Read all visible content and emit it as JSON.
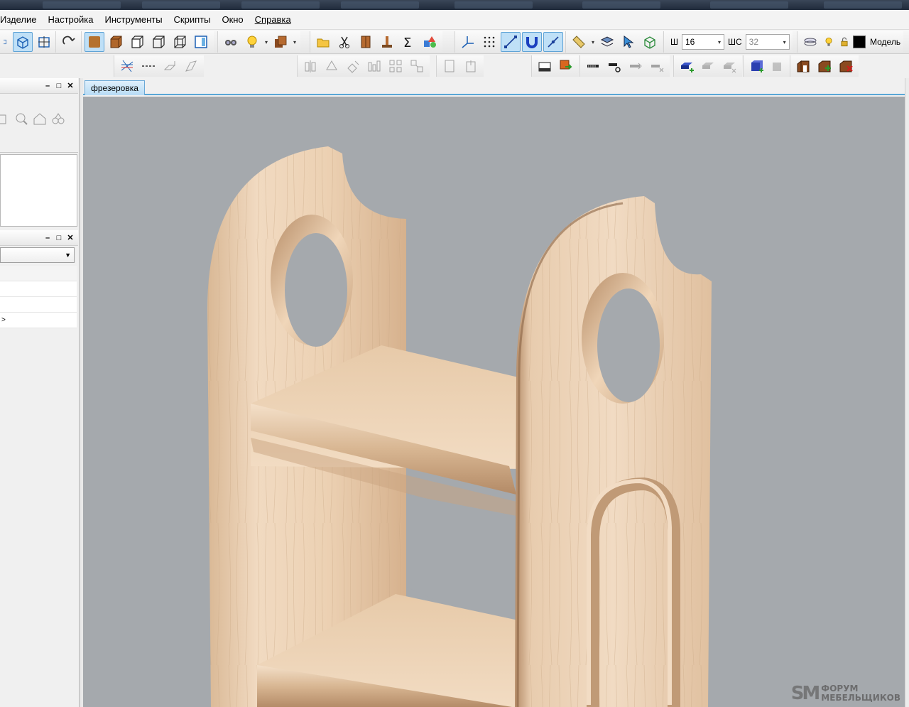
{
  "menu": {
    "items": [
      "Изделие",
      "Настройка",
      "Инструменты",
      "Скрипты",
      "Окно",
      "Справка"
    ]
  },
  "toolbar": {
    "width_label": "Ш",
    "width_value": "16",
    "shs_label": "ШС",
    "shs_value": "32",
    "model_label": "Модель",
    "color_hex": "#000000"
  },
  "tabs": [
    {
      "label": "фрезеровка",
      "active": true
    }
  ],
  "left_panel": {
    "row_marker": ">"
  },
  "watermark": {
    "logo": "SM",
    "line1": "ФОРУМ",
    "line2": "МЕБЕЛЬЩИКОВ"
  },
  "colors": {
    "viewport_bg": "#a5a9ad",
    "wood_light": "#f0d7bd",
    "wood_mid": "#e2c2a2",
    "wood_dark": "#c39b78",
    "accent": "#5aa7d6"
  }
}
